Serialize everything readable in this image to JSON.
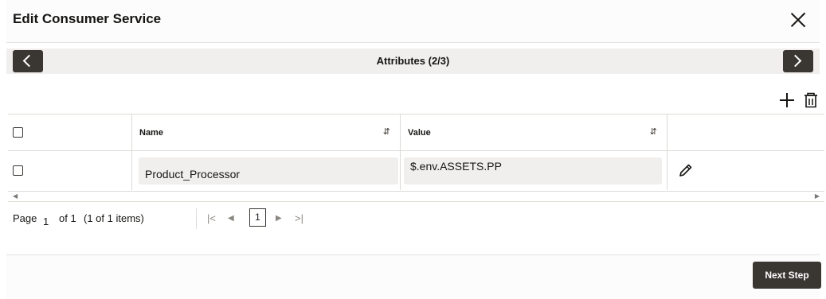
{
  "dialog": {
    "title": "Edit Consumer Service"
  },
  "step": {
    "title": "Attributes (2/3)"
  },
  "table": {
    "columns": [
      {
        "label": "Name",
        "sort_icon": "sort-icon"
      },
      {
        "label": "Value",
        "sort_icon": "sort-icon"
      }
    ],
    "rows": [
      {
        "name": "Product_Processor",
        "value": "$.env.ASSETS.PP"
      }
    ]
  },
  "pagination": {
    "page_label": "Page",
    "current_page": "1",
    "of_label": "of 1",
    "items_label": "(1 of 1 items)",
    "page_number": "1"
  },
  "footer": {
    "next_step_label": "Next Step"
  },
  "colors": {
    "primary_button": "#3a3632",
    "step_bar": "#f1efed",
    "field_bg": "#f1efed",
    "border": "#dedbd7"
  }
}
